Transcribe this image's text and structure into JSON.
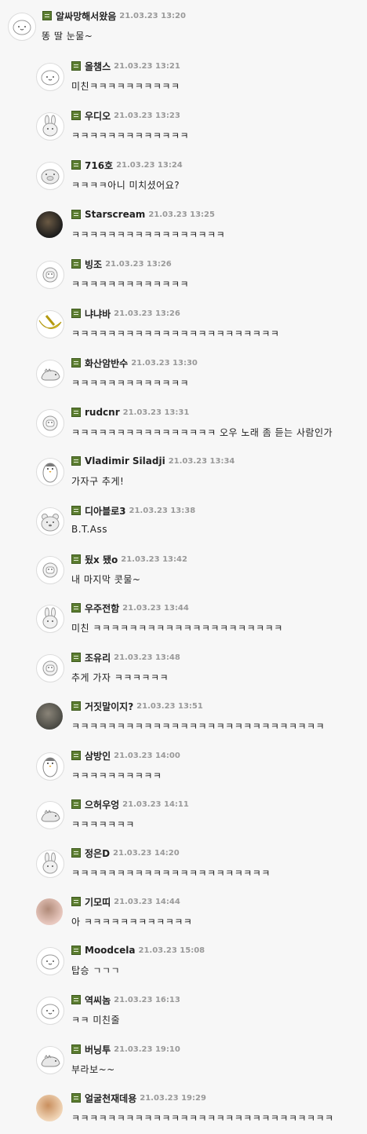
{
  "comments": [
    {
      "nick": "알싸망해서왔음",
      "date": "21.03.23 13:20",
      "text": "똥 딸 눈물~",
      "avatar": "blob-face-icon"
    },
    {
      "nick": "올챔스",
      "date": "21.03.23 13:21",
      "text": "미친ㅋㅋㅋㅋㅋㅋㅋㅋㅋㅋ",
      "avatar": "blob-face-icon"
    },
    {
      "nick": "우디오",
      "date": "21.03.23 13:23",
      "text": "ㅋㅋㅋㅋㅋㅋㅋㅋㅋㅋㅋㅋㅋ",
      "avatar": "rabbit-face-icon"
    },
    {
      "nick": "716호",
      "date": "21.03.23 13:24",
      "text": "ㅋㅋㅋㅋ아니 미치셨어요?",
      "avatar": "pig-face-icon"
    },
    {
      "nick": "Starscream",
      "date": "21.03.23 13:25",
      "text": "ㅋㅋㅋㅋㅋㅋㅋㅋㅋㅋㅋㅋㅋㅋㅋㅋㅋ",
      "avatar": "photo-avatar"
    },
    {
      "nick": "빙조",
      "date": "21.03.23 13:26",
      "text": "ㅋㅋㅋㅋㅋㅋㅋㅋㅋㅋㅋㅋㅋ",
      "avatar": "sheep-face-icon"
    },
    {
      "nick": "냐냐바",
      "date": "21.03.23 13:26",
      "text": "ㅋㅋㅋㅋㅋㅋㅋㅋㅋㅋㅋㅋㅋㅋㅋㅋㅋㅋㅋㅋㅋㅋㅋ",
      "avatar": "banana-icon"
    },
    {
      "nick": "화산암반수",
      "date": "21.03.23 13:30",
      "text": "ㅋㅋㅋㅋㅋㅋㅋㅋㅋㅋㅋㅋㅋ",
      "avatar": "dino-icon"
    },
    {
      "nick": "rudcnr",
      "date": "21.03.23 13:31",
      "text": "ㅋㅋㅋㅋㅋㅋㅋㅋㅋㅋㅋㅋㅋㅋㅋㅋ 오우 노래 좀 듣는 사람인가",
      "avatar": "sheep-face-icon"
    },
    {
      "nick": "Vladimir Siladji",
      "date": "21.03.23 13:34",
      "text": "가자구 추게!",
      "avatar": "penguin-icon"
    },
    {
      "nick": "디아블로3",
      "date": "21.03.23 13:38",
      "text": "B.T.Ass",
      "avatar": "bear-face-icon"
    },
    {
      "nick": "됬x 됐o",
      "date": "21.03.23 13:42",
      "text": "내 마지막 콧물~",
      "avatar": "sheep-face-icon"
    },
    {
      "nick": "우주전함",
      "date": "21.03.23 13:44",
      "text": "미친 ㅋㅋㅋㅋㅋㅋㅋㅋㅋㅋㅋㅋㅋㅋㅋㅋㅋㅋㅋㅋㅋ",
      "avatar": "rabbit-face-icon"
    },
    {
      "nick": "조유리",
      "date": "21.03.23 13:48",
      "text": "추게 가자 ㅋㅋㅋㅋㅋㅋ",
      "avatar": "sheep-face-icon"
    },
    {
      "nick": "거짓말이지?",
      "date": "21.03.23 13:51",
      "text": "ㅋㅋㅋㅋㅋㅋㅋㅋㅋㅋㅋㅋㅋㅋㅋㅋㅋㅋㅋㅋㅋㅋㅋㅋㅋㅋㅋㅋ",
      "avatar": "photo-avatar"
    },
    {
      "nick": "삼방인",
      "date": "21.03.23 14:00",
      "text": "ㅋㅋㅋㅋㅋㅋㅋㅋㅋㅋ",
      "avatar": "penguin-icon"
    },
    {
      "nick": "으허우엉",
      "date": "21.03.23 14:11",
      "text": "ㅋㅋㅋㅋㅋㅋㅋ",
      "avatar": "dino-icon"
    },
    {
      "nick": "정은D",
      "date": "21.03.23 14:20",
      "text": "ㅋㅋㅋㅋㅋㅋㅋㅋㅋㅋㅋㅋㅋㅋㅋㅋㅋㅋㅋㅋㅋㅋ",
      "avatar": "rabbit-face-icon"
    },
    {
      "nick": "기모띠",
      "date": "21.03.23 14:44",
      "text": "아 ㅋㅋㅋㅋㅋㅋㅋㅋㅋㅋㅋㅋ",
      "avatar": "photo-avatar"
    },
    {
      "nick": "Moodcela",
      "date": "21.03.23 15:08",
      "text": "탑승 ㄱㄱㄱ",
      "avatar": "blob-face-icon"
    },
    {
      "nick": "역씨놈",
      "date": "21.03.23 16:13",
      "text": "ㅋㅋ 미친줄",
      "avatar": "blob-face-icon"
    },
    {
      "nick": "버닝투",
      "date": "21.03.23 19:10",
      "text": "부라보~~",
      "avatar": "dino-icon"
    },
    {
      "nick": "얼굴천재데용",
      "date": "21.03.23 19:29",
      "text": "ㅋㅋㅋㅋㅋㅋㅋㅋㅋㅋㅋㅋㅋㅋㅋㅋㅋㅋㅋㅋㅋㅋㅋㅋㅋㅋㅋㅋㅋ",
      "avatar": "photo-avatar"
    }
  ]
}
